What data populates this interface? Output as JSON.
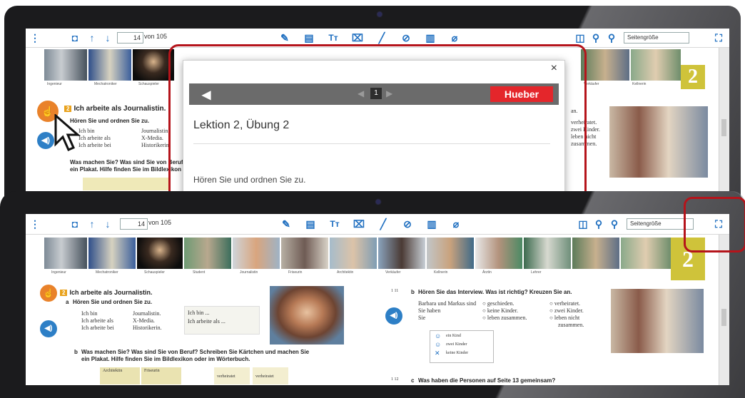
{
  "toolbar": {
    "current_page_back": "14",
    "total_pages_back": "von 105",
    "zoom_back": "Seitengröße",
    "current_page_front": "14",
    "total_pages_front": "von 105",
    "zoom_front": "Seitengröße"
  },
  "photo_captions": [
    "Ingenieur",
    "Mechatroniker",
    "Schauspieler",
    "Student",
    "Journalistin",
    "Friseurin",
    "Architektin",
    "Verkäufer",
    "Kellnerin",
    "Ärztin",
    "Lehrer"
  ],
  "lesson_badge": "2",
  "back_page": {
    "exercise_number": "2",
    "exercise_title": "Ich arbeite als Journalistin.",
    "line_a": "Hören Sie und ordnen Sie zu.",
    "col1": [
      "Ich bin",
      "Ich arbeite als",
      "Ich arbeite bei"
    ],
    "col2": [
      "Journalistin.",
      "X-Media.",
      "Historikerin."
    ],
    "line_b": "Was machen Sie? Was sind Sie von Beruf?",
    "line_b2": "ein Plakat. Hilfe finden Sie im Bildlexikon",
    "right_col": [
      "an.",
      "verheiratet.",
      "zwei Kinder.",
      "leben nicht",
      "zusammen."
    ]
  },
  "modal": {
    "close": "×",
    "page_indicator": "1",
    "brand": "Hueber",
    "title": "Lektion 2, Übung 2",
    "instruction": "Hören Sie und ordnen Sie zu."
  },
  "front_page": {
    "exercise_number": "2",
    "exercise_title": "Ich arbeite als Journalistin.",
    "line_a_label": "a",
    "line_a": "Hören Sie und ordnen Sie zu.",
    "col1": [
      "Ich bin",
      "Ich arbeite als",
      "Ich arbeite bei"
    ],
    "col2": [
      "Journalistin.",
      "X-Media.",
      "Historikerin."
    ],
    "bubble": [
      "Ich bin ...",
      "Ich arbeite als ..."
    ],
    "line_b_label": "b",
    "line_b": "Was machen Sie? Was sind Sie von Beruf? Schreiben Sie Kärtchen und machen Sie",
    "line_b2": "ein Plakat. Hilfe finden Sie im Bildlexikon oder im Wörterbuch.",
    "cards": [
      "Architektin",
      "Friseurin",
      "verheiratet",
      "verheiratet"
    ],
    "track_1_11": "1 11",
    "line_1b_label": "b",
    "line_1b": "Hören Sie das Interview. Was ist richtig? Kreuzen Sie an.",
    "interview_left": [
      "Barbara und Markus sind",
      "Sie haben",
      "Sie"
    ],
    "interview_mid": [
      "geschieden.",
      "keine Kinder.",
      "leben zusammen."
    ],
    "interview_right": [
      "verheiratet.",
      "zwei Kinder.",
      "leben nicht",
      "zusammen."
    ],
    "kids": [
      "ein Kind",
      "zwei Kinder",
      "keine Kinder"
    ],
    "track_1_12": "1 12",
    "line_c_label": "c",
    "line_c": "Was haben die Personen auf Seite 13 gemeinsam?"
  }
}
